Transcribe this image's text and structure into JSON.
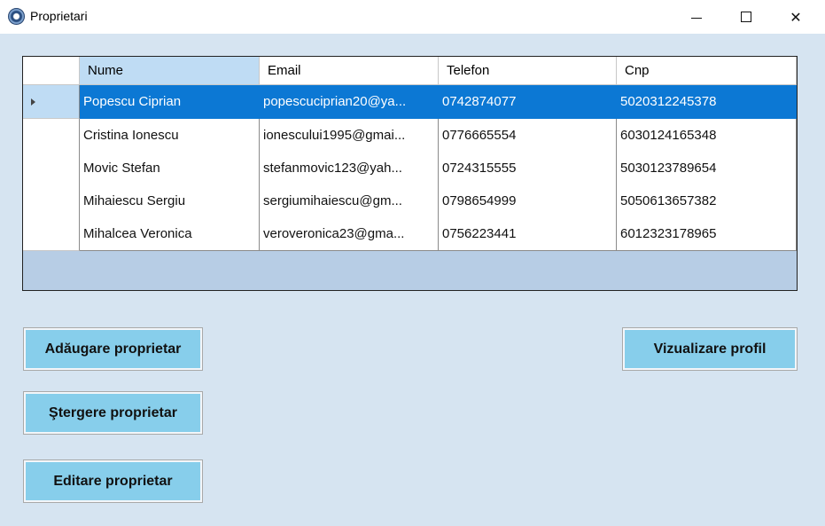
{
  "window": {
    "title": "Proprietari",
    "controls": {
      "minimize": "—",
      "maximize": "☐",
      "close": "✕"
    }
  },
  "grid": {
    "columns": [
      "Nume",
      "Email",
      "Telefon",
      "Cnp"
    ],
    "rows": [
      {
        "nume": "Popescu Ciprian",
        "email": "popescuciprian20@ya...",
        "telefon": "0742874077",
        "cnp": "5020312245378",
        "selected": true
      },
      {
        "nume": "Cristina Ionescu",
        "email": "ionescului1995@gmai...",
        "telefon": "0776665554",
        "cnp": "6030124165348"
      },
      {
        "nume": "Movic Stefan",
        "email": "stefanmovic123@yah...",
        "telefon": "0724315555",
        "cnp": "5030123789654"
      },
      {
        "nume": "Mihaiescu Sergiu",
        "email": "sergiumihaiescu@gm...",
        "telefon": "0798654999",
        "cnp": "5050613657382"
      },
      {
        "nume": "Mihalcea Veronica",
        "email": "veroveronica23@gma...",
        "telefon": "0756223441",
        "cnp": "6012323178965"
      }
    ]
  },
  "buttons": {
    "add": "Adăugare proprietar",
    "delete": "Ştergere proprietar",
    "edit": "Editare proprietar",
    "view": "Vizualizare profil"
  },
  "colors": {
    "background": "#d6e4f1",
    "selection": "#0c78d4",
    "button": "#87ceeb",
    "grid_background": "#b7cde5"
  }
}
